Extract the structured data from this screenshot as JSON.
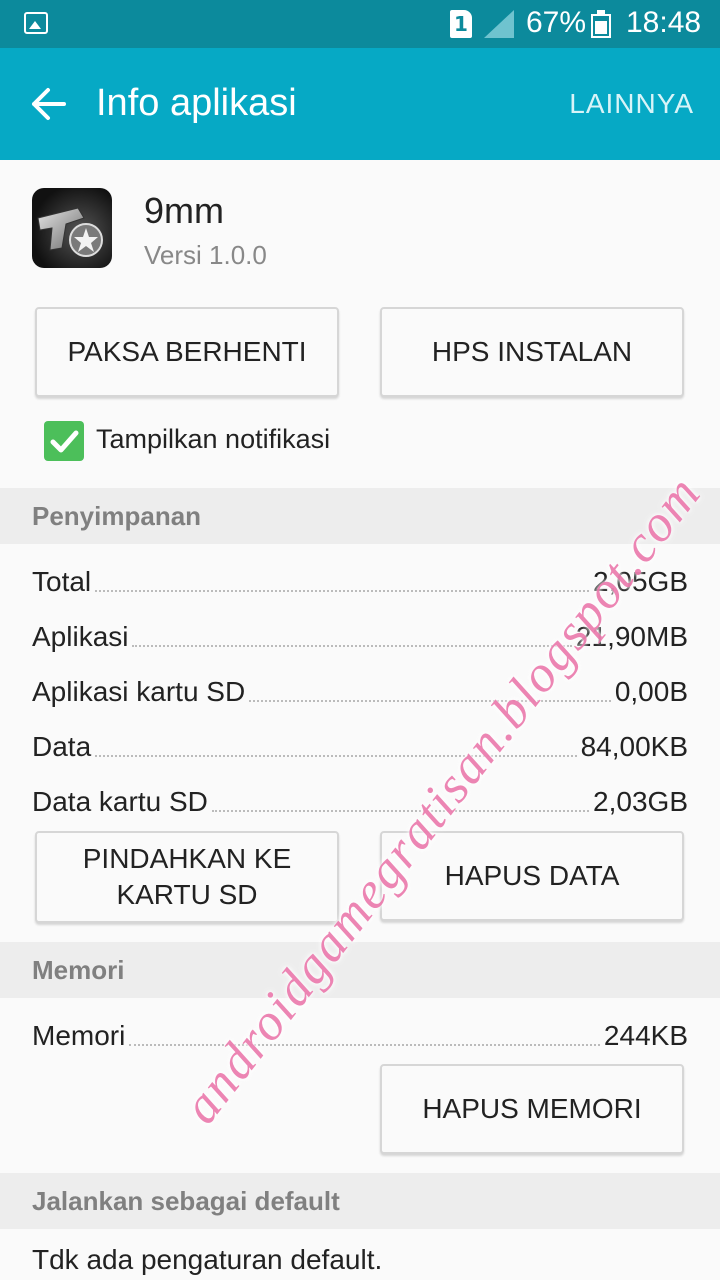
{
  "status_bar": {
    "sim_number": "1",
    "battery_percent": "67%",
    "battery_level": 0.67,
    "time": "18:48",
    "icons": [
      "image-notification-icon",
      "sim-1-icon",
      "signal-icon",
      "battery-icon"
    ]
  },
  "app_bar": {
    "title": "Info aplikasi",
    "more_label": "LAINNYA",
    "background_color": "#06a9c5"
  },
  "app": {
    "name": "9mm",
    "version": "Versi 1.0.0"
  },
  "actions": {
    "force_stop": "PAKSA BERHENTI",
    "uninstall": "HPS INSTALAN"
  },
  "notifications": {
    "label": "Tampilkan notifikasi",
    "checked": true,
    "check_color": "#4cbf5a"
  },
  "storage": {
    "header": "Penyimpanan",
    "rows": [
      {
        "label": "Total",
        "value": "2,05GB"
      },
      {
        "label": "Aplikasi",
        "value": "21,90MB"
      },
      {
        "label": "Aplikasi kartu SD",
        "value": "0,00B"
      },
      {
        "label": "Data",
        "value": "84,00KB"
      },
      {
        "label": "Data kartu SD",
        "value": "2,03GB"
      }
    ],
    "move_button": "PINDAHKAN KE KARTU SD",
    "clear_data_button": "HAPUS DATA"
  },
  "memory": {
    "header": "Memori",
    "row": {
      "label": "Memori",
      "value": "244KB"
    },
    "clear_button": "HAPUS MEMORI"
  },
  "defaults": {
    "header": "Jalankan sebagai default",
    "text": "Tdk ada pengaturan default."
  },
  "watermark": {
    "text": "androidgamegratisan.blogspot.com"
  }
}
